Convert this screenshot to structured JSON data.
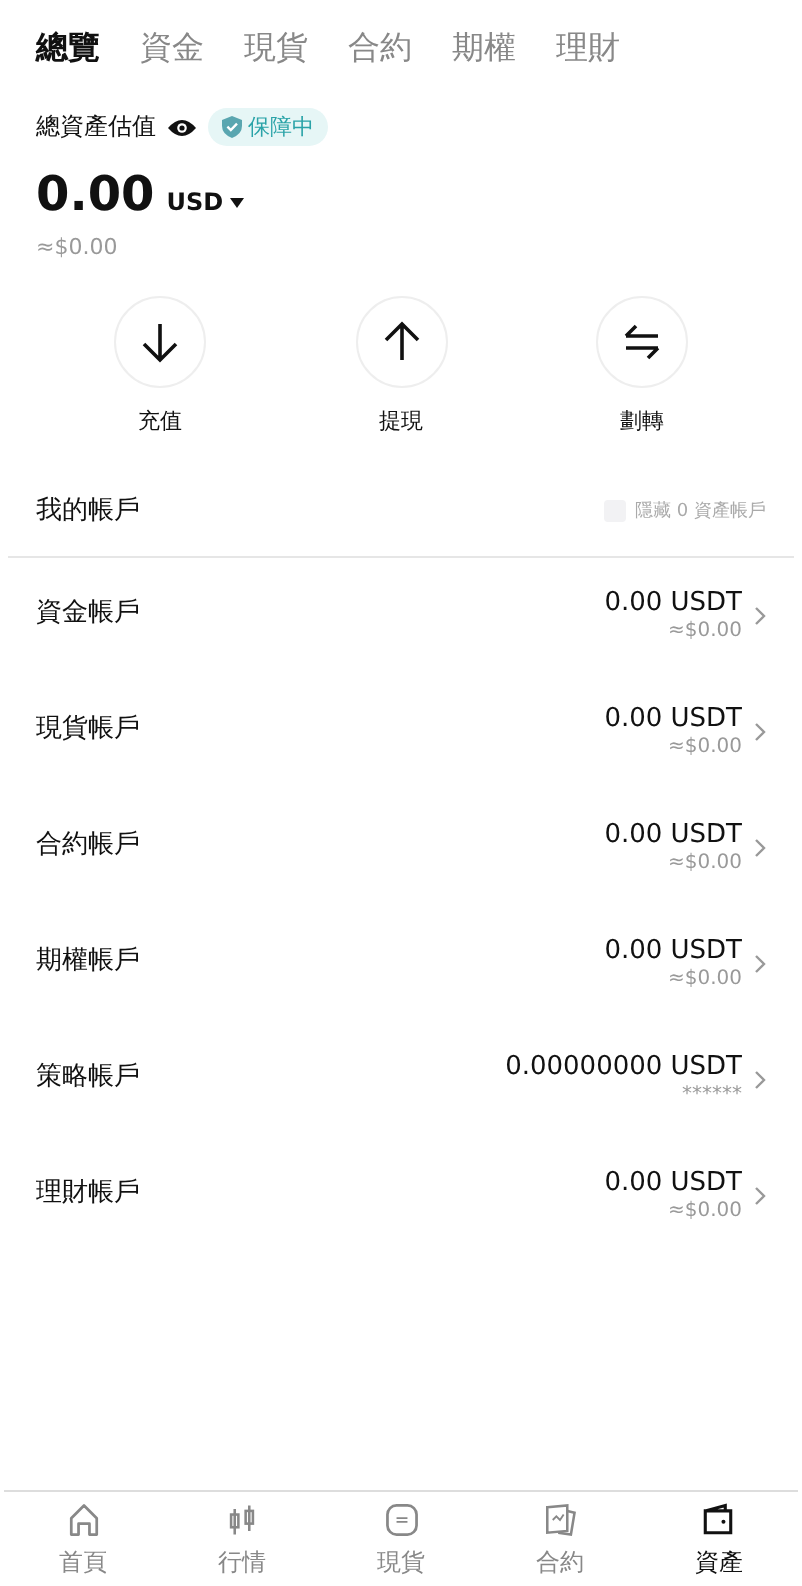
{
  "tabs": [
    {
      "label": "總覽",
      "selected": true
    },
    {
      "label": "資金",
      "selected": false
    },
    {
      "label": "現貨",
      "selected": false
    },
    {
      "label": "合約",
      "selected": false
    },
    {
      "label": "期權",
      "selected": false
    },
    {
      "label": "理財",
      "selected": false
    }
  ],
  "summary": {
    "label": "總資產估值",
    "badge": "保障中",
    "amount": "0.00",
    "currency": "USD",
    "approx": "≈$0.00"
  },
  "actions": [
    {
      "kind": "deposit",
      "label": "充值"
    },
    {
      "kind": "withdraw",
      "label": "提現"
    },
    {
      "kind": "transfer",
      "label": "劃轉"
    }
  ],
  "accounts_header": {
    "title": "我的帳戶",
    "hide_zero": {
      "label": "隱藏 0 資產帳戶",
      "checked": false
    }
  },
  "accounts": [
    {
      "name": "資金帳戶",
      "balance": "0.00 USDT",
      "approx": "≈$0.00"
    },
    {
      "name": "現貨帳戶",
      "balance": "0.00 USDT",
      "approx": "≈$0.00"
    },
    {
      "name": "合約帳戶",
      "balance": "0.00 USDT",
      "approx": "≈$0.00"
    },
    {
      "name": "期權帳戶",
      "balance": "0.00 USDT",
      "approx": "≈$0.00"
    },
    {
      "name": "策略帳戶",
      "balance": "0.00000000 USDT",
      "approx": "******"
    },
    {
      "name": "理財帳戶",
      "balance": "0.00 USDT",
      "approx": "≈$0.00"
    }
  ],
  "bottom_nav": [
    {
      "kind": "home",
      "label": "首頁",
      "selected": false
    },
    {
      "kind": "market",
      "label": "行情",
      "selected": false
    },
    {
      "kind": "spot",
      "label": "現貨",
      "selected": false
    },
    {
      "kind": "futures",
      "label": "合約",
      "selected": false
    },
    {
      "kind": "assets",
      "label": "資產",
      "selected": true
    }
  ]
}
